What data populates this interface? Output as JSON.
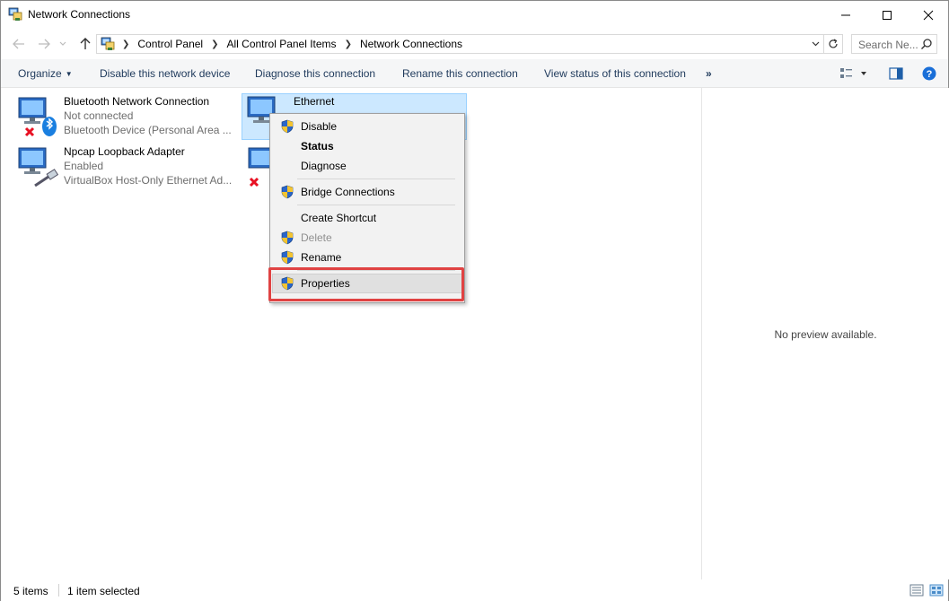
{
  "window": {
    "title": "Network Connections"
  },
  "address": {
    "crumbs": [
      "Control Panel",
      "All Control Panel Items",
      "Network Connections"
    ],
    "search_placeholder": "Search Ne..."
  },
  "commands": {
    "organize": "Organize",
    "disable": "Disable this network device",
    "diagnose": "Diagnose this connection",
    "rename": "Rename this connection",
    "view_status": "View status of this connection",
    "more": "»"
  },
  "items": [
    {
      "name": "Bluetooth Network Connection",
      "status": "Not connected",
      "device": "Bluetooth Device (Personal Area ..."
    },
    {
      "name": "Ethernet",
      "status": "",
      "device": ""
    },
    {
      "name": "Npcap Loopback Adapter",
      "status": "Enabled",
      "device": "VirtualBox Host-Only Ethernet Ad..."
    }
  ],
  "context_menu": {
    "disable": "Disable",
    "status": "Status",
    "diagnose": "Diagnose",
    "bridge": "Bridge Connections",
    "shortcut": "Create Shortcut",
    "delete": "Delete",
    "rename": "Rename",
    "properties": "Properties"
  },
  "preview": {
    "message": "No preview available."
  },
  "status": {
    "count": "5 items",
    "selected": "1 item selected"
  },
  "colors": {
    "accent": "#0078d7",
    "selection": "#cce8ff",
    "highlight_box": "#e04343",
    "error_x": "#e81123"
  }
}
